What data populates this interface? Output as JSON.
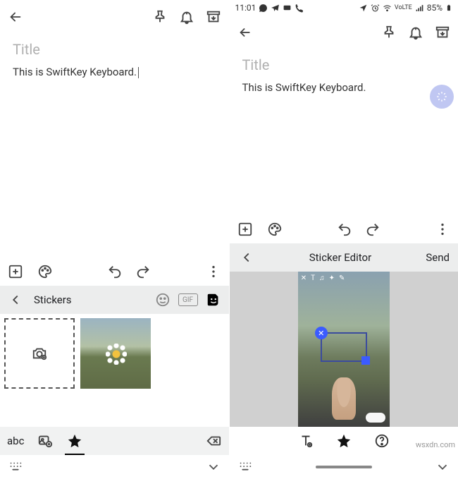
{
  "left": {
    "title_placeholder": "Title",
    "body_text": "This is SwiftKey Keyboard.",
    "stickers_label": "Stickers",
    "abc_label": "abc"
  },
  "right": {
    "status": {
      "time": "11:01",
      "battery": "85%"
    },
    "title_placeholder": "Title",
    "body_text": "This is SwiftKey Keyboard.",
    "editor_title": "Sticker Editor",
    "send_label": "Send"
  },
  "watermark": "wsxdn.com"
}
